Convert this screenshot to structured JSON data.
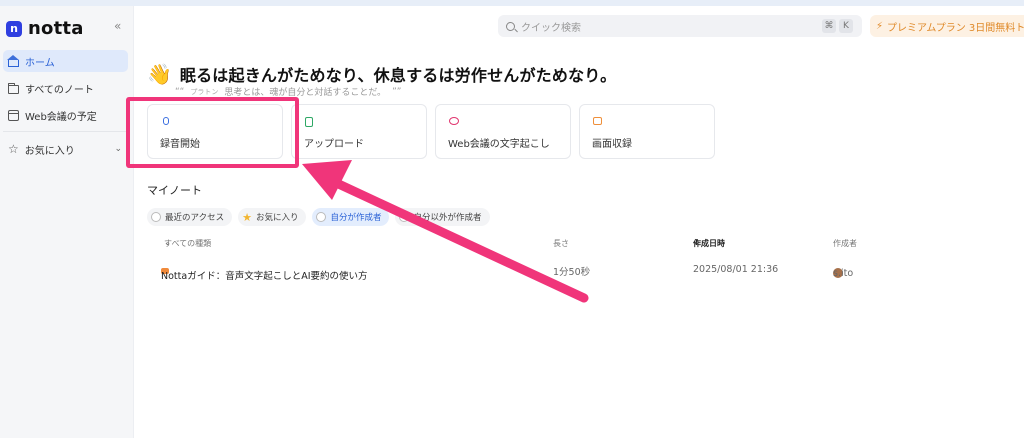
{
  "app": {
    "logo_text": "notta",
    "logo_mark": "n",
    "collapse_glyph": "«"
  },
  "sidebar": {
    "items": [
      {
        "label": "ホーム",
        "icon": "home-icon",
        "active": true
      },
      {
        "label": "すべてのノート",
        "icon": "folder-icon"
      },
      {
        "label": "Web会議の予定",
        "icon": "calendar-icon"
      },
      {
        "label": "お気に入り",
        "icon": "star-icon"
      }
    ]
  },
  "search": {
    "placeholder": "クイック検索",
    "shortcut_mod": "⌘",
    "shortcut_key": "K"
  },
  "premium": {
    "label": "プレミアムプラン 3日間無料トライアル",
    "icon": "lightning-icon"
  },
  "greeting": {
    "headline": "眠るは起きんがためなり、休息するは労作せんがためなり。",
    "quote": "思考とは、魂が自分と対話することだ。",
    "author": "プラトン",
    "open_quote": "““",
    "close_quote": "””"
  },
  "actions": [
    {
      "label": "録音開始",
      "icon": "microphone-icon",
      "color": "#3b6fe0"
    },
    {
      "label": "アップロード",
      "icon": "upload-icon",
      "color": "#2ea865"
    },
    {
      "label": "Web会議の文字起こし",
      "icon": "web-meeting-icon",
      "color": "#e0336d"
    },
    {
      "label": "画面収録",
      "icon": "screen-record-icon",
      "color": "#ef8f3a"
    }
  ],
  "my_notes": {
    "title": "マイノート",
    "filters": [
      {
        "label": "最近のアクセス"
      },
      {
        "label": "お気に入り"
      },
      {
        "label": "自分が作成者",
        "active": true
      },
      {
        "label": "自分以外が作成者"
      }
    ],
    "columns": {
      "type": "すべての種類",
      "length": "長さ",
      "created": "作成日時",
      "creator": "作成者"
    },
    "rows": [
      {
        "title": "Nottaガイド：音声文字起こしとAI要約の使い方",
        "length": "1分50秒",
        "created": "2025/08/01 21:36",
        "creator": "s.ito"
      }
    ]
  },
  "annotation": {
    "highlight_color": "#f0357a"
  }
}
